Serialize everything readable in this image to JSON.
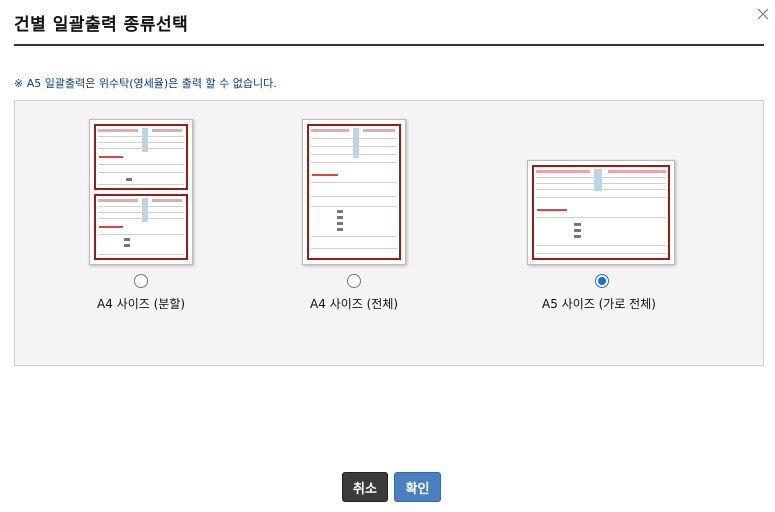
{
  "dialog": {
    "title": "건별 일괄출력 종류선택",
    "notice": "※ A5 일괄출력은 위수탁(영세율)은 출력 할 수 없습니다."
  },
  "options": [
    {
      "label": "A4 사이즈 (분할)",
      "selected": false
    },
    {
      "label": "A4 사이즈 (전체)",
      "selected": false
    },
    {
      "label": "A5 사이즈 (가로 전체)",
      "selected": true
    }
  ],
  "buttons": {
    "cancel": "취소",
    "confirm": "확인"
  },
  "colors": {
    "accent": "#1a6fd6",
    "confirm_button": "#4a7fc0",
    "cancel_button": "#3b3b3b",
    "notice_text": "#0a3c7a",
    "sheet_border": "#9b1b1b"
  }
}
